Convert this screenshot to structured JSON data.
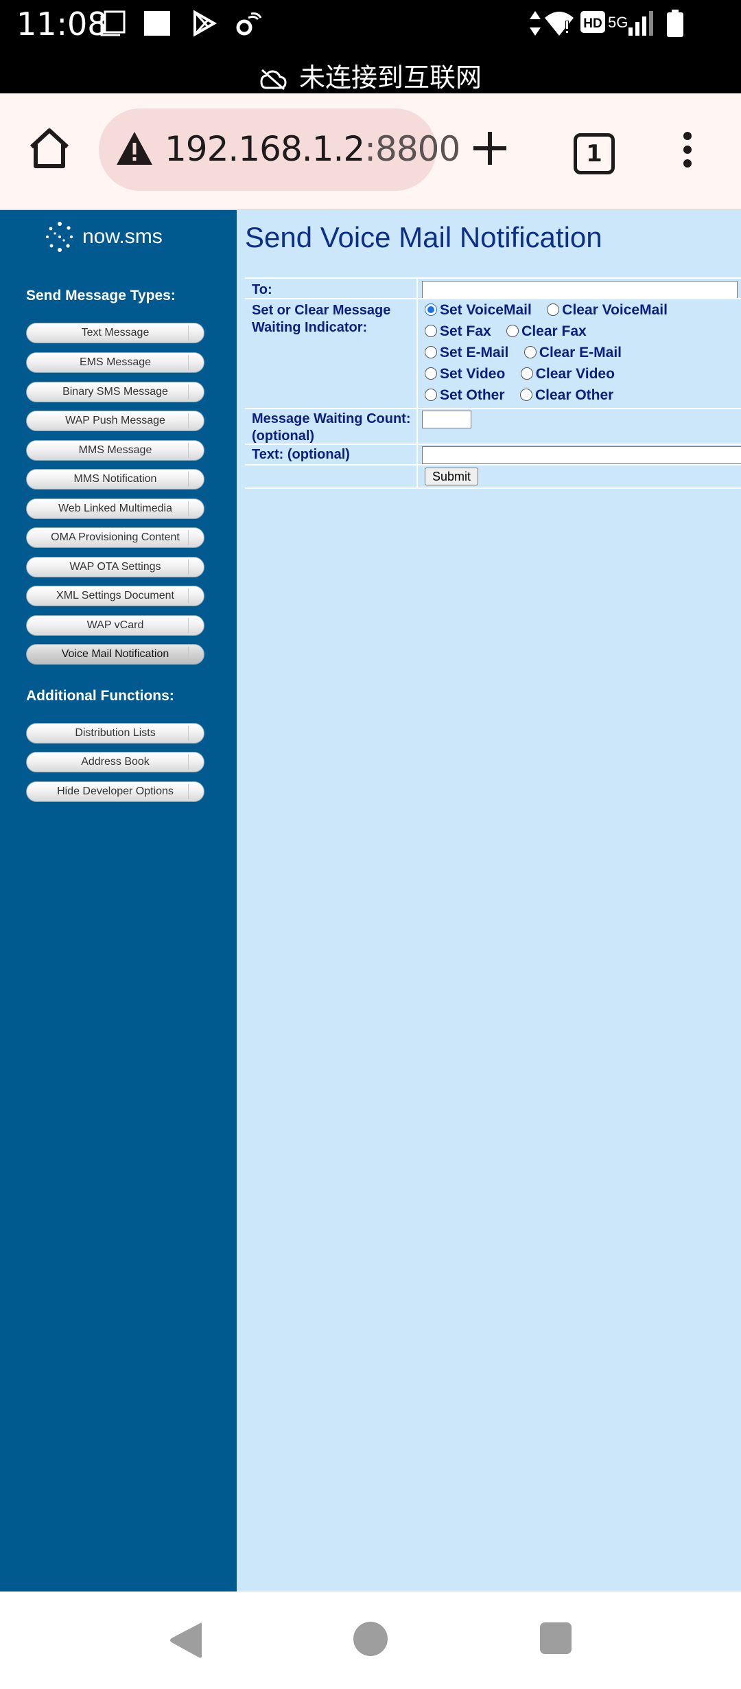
{
  "status_bar": {
    "time": "11:08",
    "network": "5G"
  },
  "offline_banner": {
    "text": "未连接到互联网",
    "icon": "cloud-off-icon"
  },
  "browser": {
    "url_host": "192.168.1.2",
    "url_port": ":8800",
    "tab_count": "1",
    "icons": [
      "home-icon",
      "warning-icon",
      "plus-icon",
      "tab-switcher-icon",
      "more-menu-icon"
    ]
  },
  "sidebar": {
    "logo_text": "now.sms",
    "section1_title": "Send Message Types:",
    "message_types": [
      "Text Message",
      "EMS Message",
      "Binary SMS Message",
      "WAP Push Message",
      "MMS Message",
      "MMS Notification",
      "Web Linked Multimedia",
      "OMA Provisioning Content",
      "WAP OTA Settings",
      "XML Settings Document",
      "WAP vCard",
      "Voice Mail Notification"
    ],
    "active_item": "Voice Mail Notification",
    "section2_title": "Additional Functions:",
    "functions": [
      "Distribution Lists",
      "Address Book",
      "Hide Developer Options"
    ]
  },
  "main": {
    "title": "Send Voice Mail Notification",
    "to_label": "To:",
    "to_value": "",
    "indicator_label": "Set or Clear Message Waiting Indicator:",
    "indicator_options": [
      {
        "set": "Set VoiceMail",
        "clear": "Clear VoiceMail"
      },
      {
        "set": "Set Fax",
        "clear": "Clear Fax"
      },
      {
        "set": "Set E-Mail",
        "clear": "Clear E-Mail"
      },
      {
        "set": "Set Video",
        "clear": "Clear Video"
      },
      {
        "set": "Set Other",
        "clear": "Clear Other"
      }
    ],
    "selected_option": "Set VoiceMail",
    "count_label": "Message Waiting Count: (optional)",
    "count_value": "",
    "text_label": "Text: (optional)",
    "text_value": "",
    "submit_label": "Submit"
  },
  "colors": {
    "sidebar_bg": "#005a8f",
    "main_bg": "#cce6fa",
    "label_text": "#0c1f80",
    "title_text": "#0c2f8a",
    "radio_accent": "#1a73e8"
  }
}
